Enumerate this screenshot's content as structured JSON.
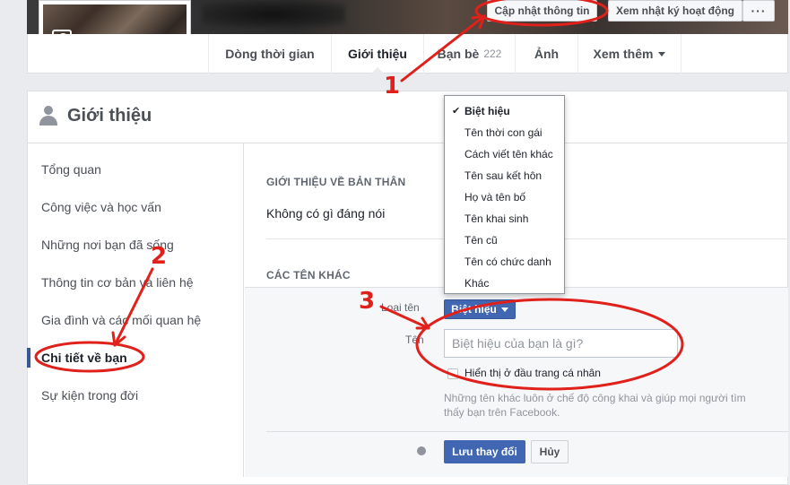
{
  "header": {
    "update_info_button": "Cập nhật thông tin",
    "activity_log_button": "Xem nhật ký hoạt động",
    "more_button": "···"
  },
  "tabs": {
    "timeline": "Dòng thời gian",
    "about": "Giới thiệu",
    "friends": "Bạn bè",
    "friends_count": "222",
    "photos": "Ảnh",
    "more": "Xem thêm"
  },
  "about": {
    "title": "Giới thiệu",
    "nav": [
      "Tổng quan",
      "Công việc và học vấn",
      "Những nơi bạn đã sống",
      "Thông tin cơ bản và liên hệ",
      "Gia đình và các mối quan hệ",
      "Chi tiết về bạn",
      "Sự kiện trong đời"
    ],
    "bio_section_label": "GIỚI THIỆU VỀ BẢN THÂN",
    "bio_text": "Không có gì đáng nói",
    "other_names_label": "CÁC TÊN KHÁC"
  },
  "form": {
    "type_label": "Loại tên",
    "name_label": "Tên",
    "type_selected": "Biệt hiệu",
    "name_placeholder": "Biệt hiệu của bạn là gì?",
    "show_on_top_label": "Hiển thị ở đầu trang cá nhân",
    "help_text": "Những tên khác luôn ở chế độ công khai và giúp mọi người tìm thấy bạn trên Facebook.",
    "save_button": "Lưu thay đổi",
    "cancel_button": "Hủy"
  },
  "dropdown": {
    "selected_index": 0,
    "options": [
      "Biệt hiệu",
      "Tên thời con gái",
      "Cách viết tên khác",
      "Tên sau kết hôn",
      "Họ và tên bố",
      "Tên khai sinh",
      "Tên cũ",
      "Tên có chức danh",
      "Khác"
    ]
  },
  "annotations": {
    "step_1": "1",
    "step_2": "2",
    "step_3": "3",
    "color": "#e0201a"
  },
  "colors": {
    "primary_button": "#4267b2",
    "active_nav_bar": "#365899",
    "page_background": "#e9ebee"
  }
}
